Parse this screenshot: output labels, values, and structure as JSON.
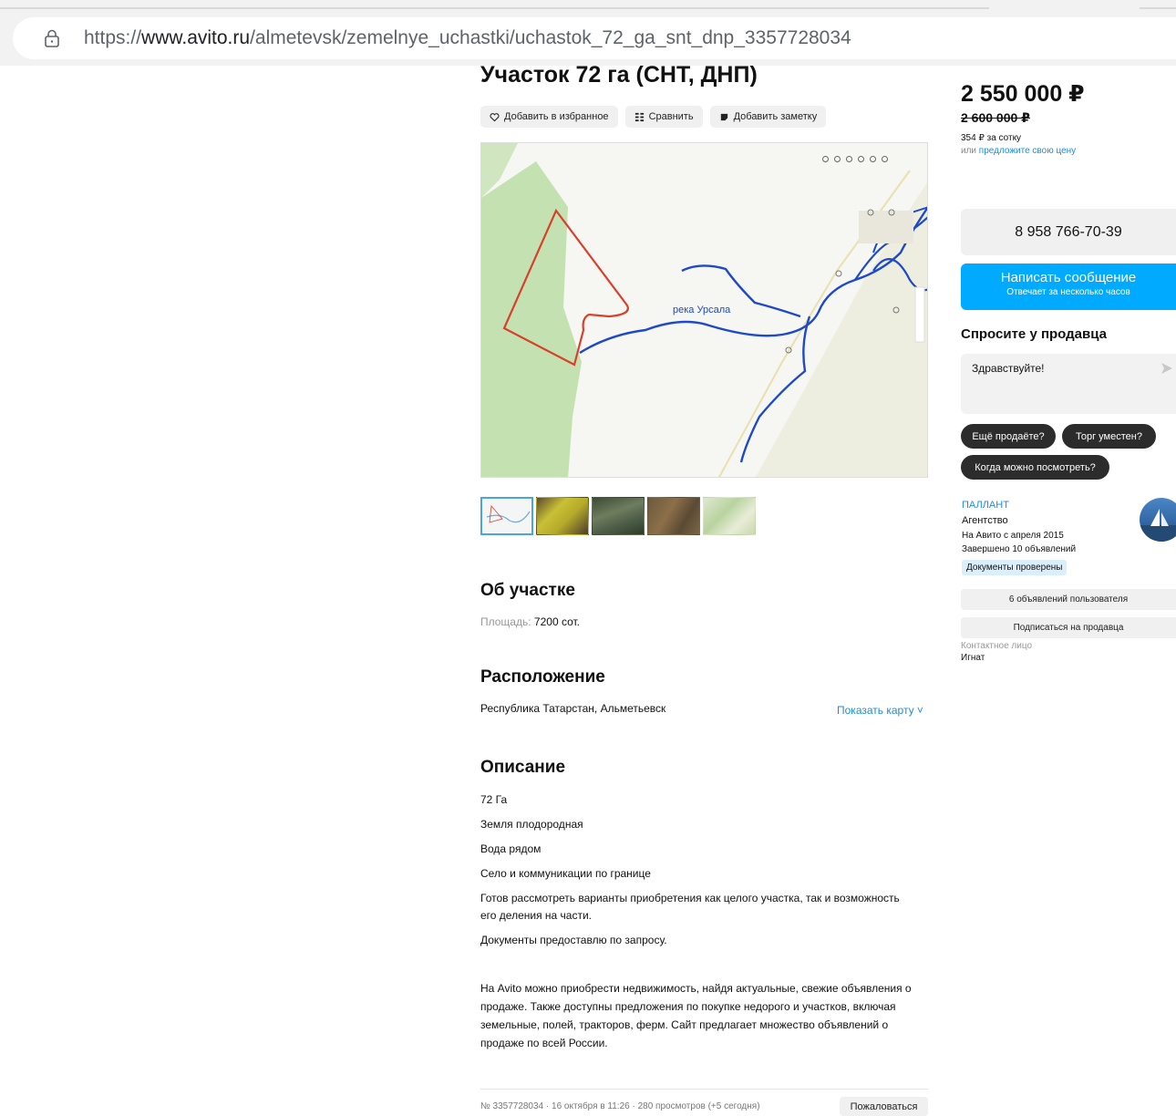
{
  "browser": {
    "url_prefix": "https://",
    "url_domain": "www.avito.ru",
    "url_path": "/almetevsk/zemelnye_uchastki/uchastok_72_ga_snt_dnp_3357728034"
  },
  "listing": {
    "title": "Участок 72 га (СНТ, ДНП)",
    "actions": {
      "favorite": "Добавить в избранное",
      "compare": "Сравнить",
      "note": "Добавить заметку"
    },
    "map": {
      "river_label": "река Урсала"
    },
    "thumbnails": [
      {
        "name": "map"
      },
      {
        "name": "satellite-yellow"
      },
      {
        "name": "satellite-green"
      },
      {
        "name": "satellite-brown"
      },
      {
        "name": "satellite-light"
      }
    ]
  },
  "about": {
    "heading": "Об участке",
    "area_label": "Площадь:",
    "area_value": "7200 сот."
  },
  "location": {
    "heading": "Расположение",
    "address": "Республика Татарстан, Альметьевск",
    "show_map": "Показать карту ˅"
  },
  "description": {
    "heading": "Описание",
    "lines": [
      "72 Га",
      "Земля плодородная",
      "Вода рядом",
      "Село и коммуникации по границе",
      "Готов рассмотреть варианты приобретения как целого участка, так и возможность его деления на части.",
      "Документы предоставлю по запросу."
    ],
    "seo_text": "На Avito можно приобрести недвижимость, найдя актуальные, свежие объявления о продаже. Также доступны предложения по покупке недорого и участков, включая земельные, полей, тракторов, ферм. Сайт предлагает множество объявлений о продаже по всей России."
  },
  "footer": {
    "meta": "№ 3357728034 · 16 октября в 11:26 · 280 просмотров (+5 сегодня)",
    "complain": "Пожаловаться"
  },
  "sidebar": {
    "price": "2 550 000 ₽",
    "old_price": "2 600 000 ₽",
    "price_per": "354 ₽ за сотку",
    "offer_prefix": "или ",
    "offer_link": "предложите свою цену",
    "phone": "8 958 766-70-39",
    "message_title": "Написать сообщение",
    "message_sub": "Отвечает за несколько часов",
    "ask_heading": "Спросите у продавца",
    "ask_text": "Здравствуйте!",
    "chips": [
      "Ещё продаёте?",
      "Торг уместен?",
      "Когда можно посмотреть?"
    ],
    "seller": {
      "name": "ПАЛЛАНТ",
      "type": "Агентство",
      "since": "На Авито с апреля 2015",
      "completed": "Завершено 10 объявлений",
      "docs": "Документы проверены"
    },
    "user_ads": "6 объявлений пользователя",
    "subscribe": "Подписаться на продавца",
    "contact_label": "Контактное лицо",
    "contact_name": "Игнат"
  },
  "colors": {
    "accent": "#00aaff",
    "link": "#1b8ce3",
    "plot_border": "#d8402b",
    "river": "#1e49c8"
  }
}
